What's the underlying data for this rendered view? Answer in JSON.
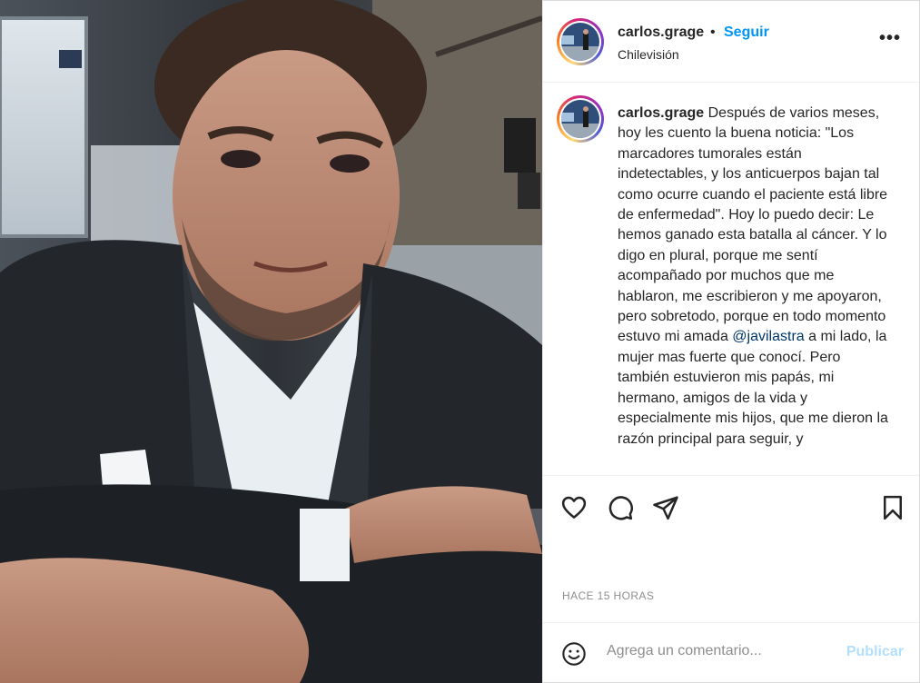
{
  "post": {
    "author": "carlos.grage",
    "separator": "•",
    "follow_label": "Seguir",
    "location": "Chilevisión",
    "more_label": "•••",
    "caption": {
      "username": "carlos.grage",
      "text_before_mention": "Después de varios meses, hoy les cuento la buena noticia: \"Los marcadores tumorales están indetectables, y los anticuerpos bajan tal como ocurre cuando el paciente está libre de enfermedad\". Hoy lo puedo decir: Le hemos ganado esta batalla al cáncer. Y lo digo en plural, porque me sentí acompañado por muchos que me hablaron, me escribieron y me apoyaron, pero sobretodo, porque en todo momento estuvo mi amada",
      "mention": "@javilastra",
      "text_after_mention": "a mi lado, la mujer mas fuerte que conocí. Pero también estuvieron mis papás, mi hermano, amigos de la vida y especialmente mis hijos, que me dieron la razón principal para seguir, y"
    },
    "timestamp": "HACE 15 HORAS",
    "comment_placeholder": "Agrega un comentario...",
    "publish_label": "Publicar"
  },
  "icons": {
    "like": "heart-icon",
    "comment": "comment-bubble-icon",
    "share": "paper-plane-icon",
    "save": "bookmark-icon",
    "emoji": "smiley-icon",
    "more": "more-options-icon"
  },
  "colors": {
    "link_blue": "#0095f6",
    "mention_blue": "#00376b",
    "muted_gray": "#8e8e8e",
    "publish_disabled": "#b2dffc",
    "text": "#262626"
  }
}
